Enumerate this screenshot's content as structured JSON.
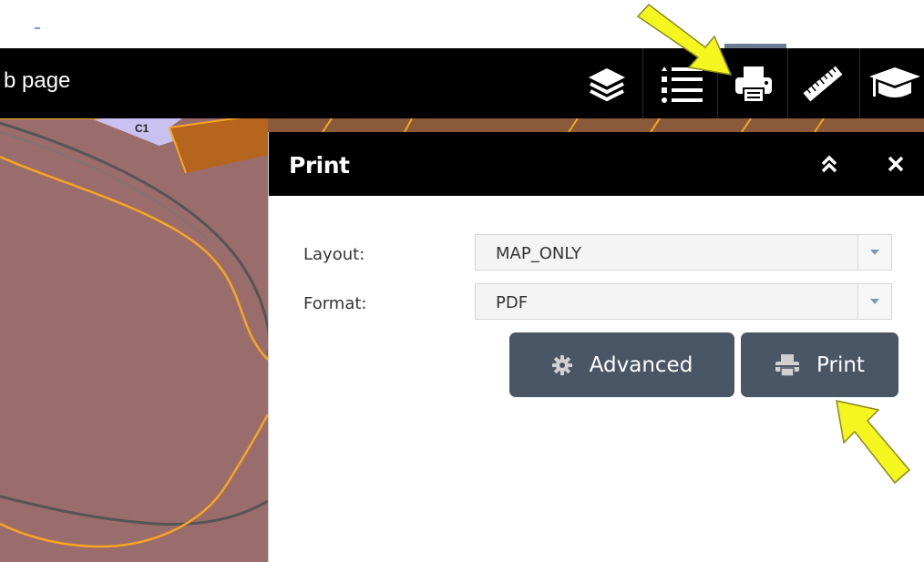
{
  "header": {
    "title_fragment": "b page",
    "tools": [
      {
        "name": "layers-icon"
      },
      {
        "name": "legend-list-icon"
      },
      {
        "name": "print-icon"
      },
      {
        "name": "measure-ruler-icon"
      },
      {
        "name": "education-cap-icon"
      }
    ]
  },
  "map": {
    "parcel_label": "C1",
    "colors": {
      "parcel_fill": "#9b6c6c",
      "boundary": "#f5a623",
      "road": "#555555",
      "parcel_orange": "#b5651d",
      "label_box": "#c9c2f0"
    }
  },
  "print_panel": {
    "title": "Print",
    "layout_label": "Layout:",
    "layout_value": "MAP_ONLY",
    "format_label": "Format:",
    "format_value": "PDF",
    "advanced_label": "Advanced",
    "print_label": "Print"
  },
  "annotations": {
    "arrow_color": "#f5f520"
  }
}
